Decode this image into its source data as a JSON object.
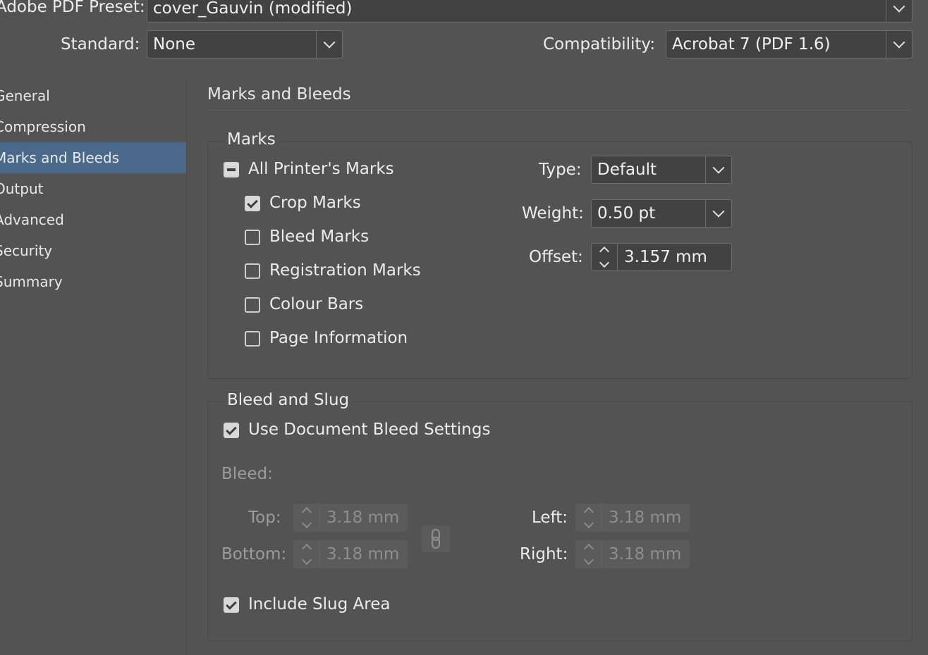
{
  "header": {
    "preset_label": "Adobe PDF Preset:",
    "preset_value": "cover_Gauvin (modified)",
    "standard_label": "Standard:",
    "standard_value": "None",
    "compat_label": "Compatibility:",
    "compat_value": "Acrobat 7 (PDF 1.6)"
  },
  "sidebar": {
    "items": [
      {
        "label": "General"
      },
      {
        "label": "Compression"
      },
      {
        "label": "Marks and Bleeds",
        "selected": true
      },
      {
        "label": "Output"
      },
      {
        "label": "Advanced"
      },
      {
        "label": "Security"
      },
      {
        "label": "Summary"
      }
    ]
  },
  "section": {
    "title": "Marks and Bleeds"
  },
  "marks": {
    "legend": "Marks",
    "all_printers_marks": {
      "label": "All Printer's Marks",
      "state": "mixed"
    },
    "items": [
      {
        "label": "Crop Marks",
        "checked": true
      },
      {
        "label": "Bleed Marks",
        "checked": false
      },
      {
        "label": "Registration Marks",
        "checked": false
      },
      {
        "label": "Colour Bars",
        "checked": false
      },
      {
        "label": "Page Information",
        "checked": false
      }
    ],
    "type_label": "Type:",
    "type_value": "Default",
    "weight_label": "Weight:",
    "weight_value": "0.50 pt",
    "offset_label": "Offset:",
    "offset_value": "3.157 mm"
  },
  "bleed_slug": {
    "legend": "Bleed and Slug",
    "use_doc_bleed": {
      "label": "Use Document Bleed Settings",
      "checked": true
    },
    "bleed_label": "Bleed:",
    "top_label": "Top:",
    "top_value": "3.18 mm",
    "bottom_label": "Bottom:",
    "bottom_value": "3.18 mm",
    "left_label": "Left:",
    "left_value": "3.18 mm",
    "right_label": "Right:",
    "right_value": "3.18 mm",
    "include_slug": {
      "label": "Include Slug Area",
      "checked": true
    }
  },
  "icons": {
    "dropdown_arrow": "chevron-down-icon",
    "spinner": "spinner-arrows-icon",
    "link": "chain-link-icon"
  },
  "colors": {
    "background": "#535353",
    "selection": "#4b6a8b",
    "field": "#424242"
  }
}
